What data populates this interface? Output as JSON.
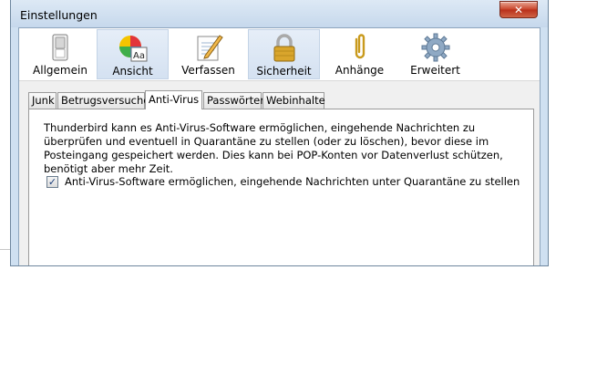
{
  "window": {
    "title": "Einstellungen",
    "close_glyph": "✕"
  },
  "toolbar": {
    "panes": [
      {
        "label": "Allgemein",
        "icon": "switch-icon",
        "active": false
      },
      {
        "label": "Ansicht",
        "icon": "color-wheel-font-icon",
        "active": true
      },
      {
        "label": "Verfassen",
        "icon": "notepad-pencil-icon",
        "active": false
      },
      {
        "label": "Sicherheit",
        "icon": "padlock-icon",
        "active": true
      },
      {
        "label": "Anhänge",
        "icon": "paperclip-icon",
        "active": false
      },
      {
        "label": "Erweitert",
        "icon": "gear-icon",
        "active": false
      }
    ]
  },
  "tabs": [
    {
      "label": "Junk"
    },
    {
      "label": "Betrugsversuche"
    },
    {
      "label": "Anti-Virus",
      "selected": true
    },
    {
      "label": "Passwörter"
    },
    {
      "label": "Webinhalte"
    }
  ],
  "antivirus": {
    "description": "Thunderbird kann es Anti-Virus-Software ermöglichen, eingehende Nachrichten zu überprüfen und eventuell in Quarantäne zu stellen (oder zu löschen), bevor diese im Posteingang gespeichert werden. Dies kann bei POP-Konten vor Datenverlust schützen, benötigt aber mehr Zeit.",
    "checkbox_label": "Anti-Virus-Software ermöglichen, eingehende Nachrichten unter Quarantäne zu stellen",
    "checkbox_checked": true,
    "check_glyph": "✓"
  }
}
